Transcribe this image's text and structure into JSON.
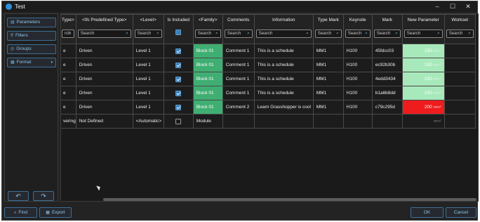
{
  "window": {
    "title": "Test",
    "min_glyph": "–",
    "max_glyph": "☐",
    "close_glyph": "✕"
  },
  "sidebar": {
    "buttons": [
      {
        "label": "Parameters",
        "icon": "list-icon",
        "glyph": "▤"
      },
      {
        "label": "Filters",
        "icon": "filter-icon",
        "glyph": "∇"
      },
      {
        "label": "Groups",
        "icon": "groups-icon",
        "glyph": "◎"
      },
      {
        "label": "Format",
        "icon": "format-icon",
        "glyph": "▦",
        "dropdown": "▾"
      }
    ],
    "undo_glyph": "↶",
    "redo_glyph": "↷"
  },
  "grid": {
    "search_placeholder": "Search",
    "partial_search_placeholder": "rch",
    "columns": [
      "Type>",
      "<Ifc Predefined Type>",
      "<Level>",
      "Is Included",
      "<Family>",
      "Comments",
      "Information",
      "Type Mark",
      "Keynote",
      "Mark",
      "New Parameter",
      "Workset"
    ],
    "rows": [
      {
        "type": "e",
        "ifc": "Driven",
        "level": "Level 1",
        "included": true,
        "family": "Block 01",
        "comments": "Comment 1",
        "information": "This is a schedule",
        "type_mark": "MM1",
        "keynote": "H100",
        "mark": "45fdcc03",
        "new_param": "150",
        "unit": "mm²",
        "workset": ""
      },
      {
        "type": "e",
        "ifc": "Driven",
        "level": "Level 1",
        "included": true,
        "family": "Block 01",
        "comments": "Comment 1",
        "information": "This is a schedule",
        "type_mark": "MM1",
        "keynote": "H100",
        "mark": "ec92b30b",
        "new_param": "150",
        "unit": "mm²",
        "workset": ""
      },
      {
        "type": "e",
        "ifc": "Driven",
        "level": "Level 1",
        "included": true,
        "family": "Block 01",
        "comments": "Comment 1",
        "information": "This is a schedule",
        "type_mark": "MM1",
        "keynote": "H100",
        "mark": "4edd3434",
        "new_param": "150",
        "unit": "mm²",
        "workset": ""
      },
      {
        "type": "e",
        "ifc": "Driven",
        "level": "Level 1",
        "included": true,
        "family": "Block 01",
        "comments": "Comment 1",
        "information": "This is a schedule",
        "type_mark": "MM1",
        "keynote": "H100",
        "mark": "b1a6b8dd",
        "new_param": "150",
        "unit": "mm²",
        "workset": ""
      },
      {
        "type": "e",
        "ifc": "Driven",
        "level": "Level 1",
        "included": true,
        "family": "Block 01",
        "comments": "Comment 2",
        "information": "Learn Grasshopper is cool",
        "type_mark": "MM1",
        "keynote": "H100",
        "mark": "c79c295d",
        "new_param": "200",
        "unit": "mm²",
        "workset": ""
      },
      {
        "type": "vering",
        "ifc": "Not Defined",
        "level": "<Automatic>",
        "included": false,
        "family": "Module",
        "comments": "",
        "information": "",
        "type_mark": "",
        "keynote": "",
        "mark": "",
        "new_param": "",
        "unit": "mm²",
        "workset": ""
      }
    ]
  },
  "footer": {
    "find_label": "Find",
    "find_glyph": "⌕",
    "export_label": "Export",
    "export_glyph": "▦",
    "ok_label": "OK",
    "cancel_label": "Cancel"
  },
  "colors": {
    "accent": "#3d7fb6",
    "family_green": "#3fae72",
    "ok_value_green": "#a8e9bb",
    "error_red": "#ee1c1c"
  }
}
